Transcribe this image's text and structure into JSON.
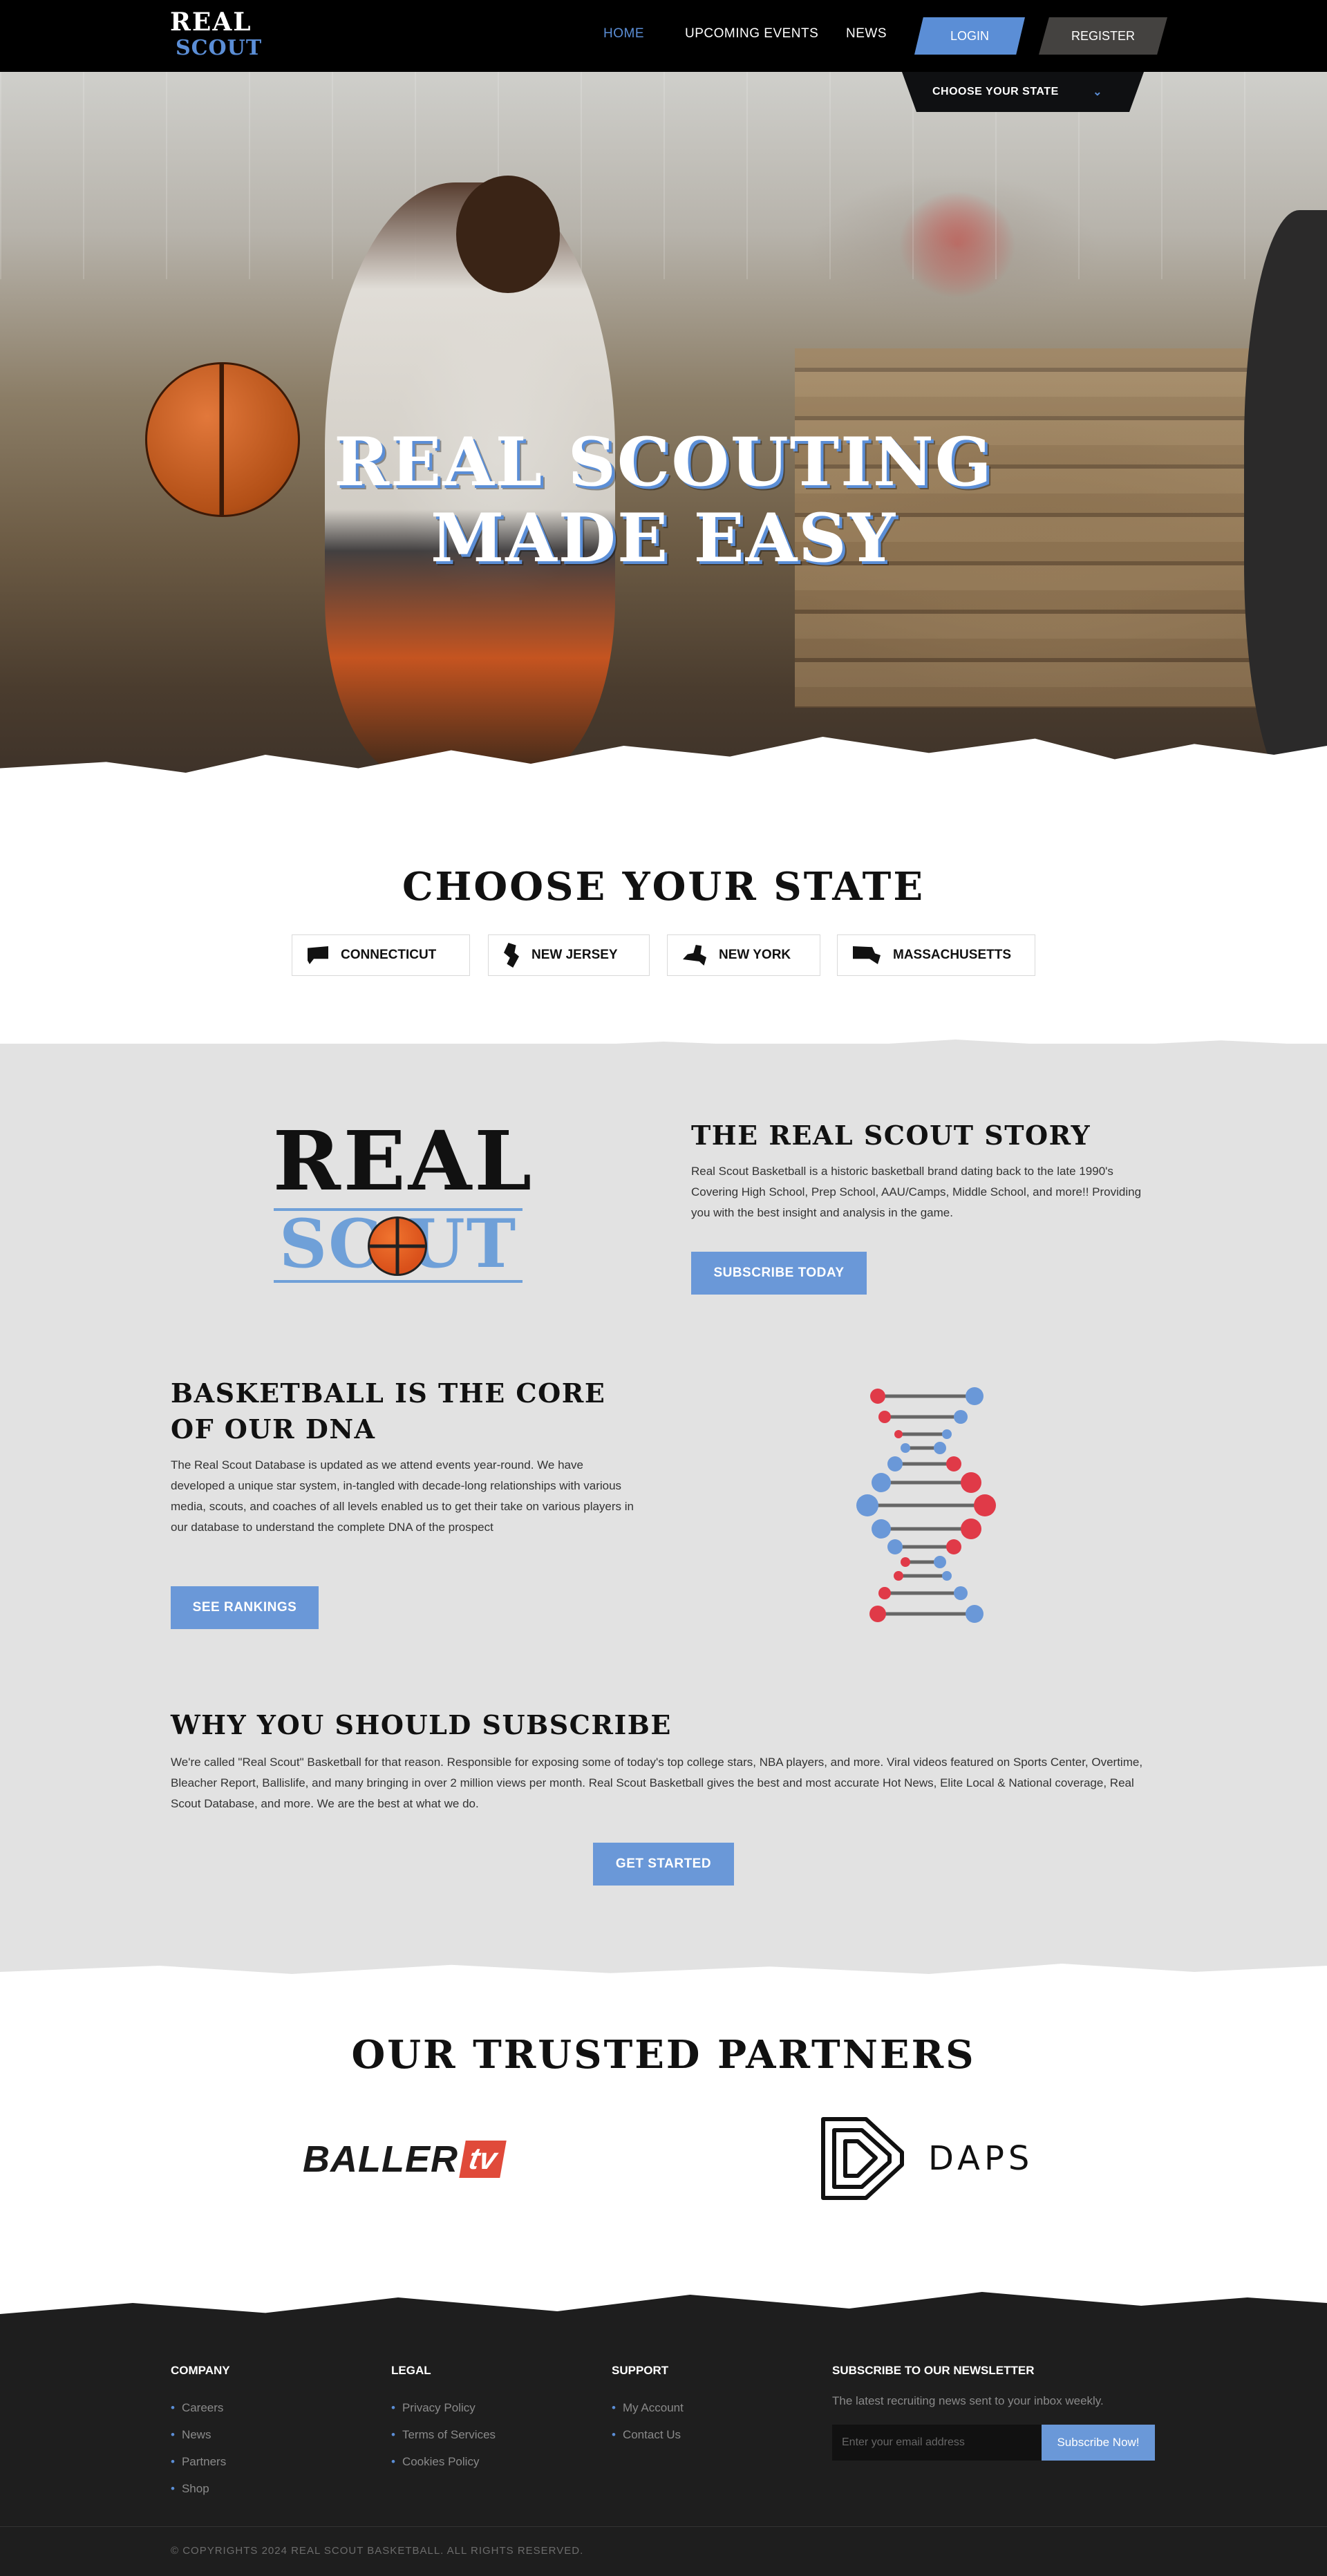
{
  "nav": {
    "logo_top": "REAL",
    "logo_bottom": "SCOUT",
    "links": [
      "HOME",
      "UPCOMING EVENTS",
      "NEWS"
    ],
    "login": "LOGIN",
    "register": "REGISTER",
    "state_dropdown": "CHOOSE YOUR STATE"
  },
  "hero": {
    "line1": "REAL SCOUTING",
    "line2": "MADE EASY"
  },
  "states": {
    "title": "CHOOSE YOUR STATE",
    "items": [
      "CONNECTICUT",
      "NEW JERSEY",
      "NEW YORK",
      "MASSACHUSETTS"
    ]
  },
  "story": {
    "logo_top": "REAL",
    "logo_bottom": "SC UT",
    "title": "THE REAL SCOUT STORY",
    "text": "Real Scout Basketball is a historic basketball brand dating back to the late 1990's   Covering High School, Prep School, AAU/Camps, Middle School, and more!! Providing you with the best insight and analysis in the game.",
    "button": "SUBSCRIBE TODAY"
  },
  "dna": {
    "title": "BASKETBALL IS THE CORE OF OUR DNA",
    "text": "The Real Scout Database is updated as we attend events year-round. We have developed a unique star system, in-tangled with decade-long relationships with various media, scouts, and coaches of all levels enabled us to get their take on various players in our database to understand the complete DNA of the prospect",
    "button": "SEE RANKINGS"
  },
  "why": {
    "title": "WHY YOU SHOULD SUBSCRIBE",
    "text": "We're called \"Real Scout\" Basketball for that reason. Responsible for exposing some of today's top college stars, NBA players, and more. Viral videos featured on Sports Center, Overtime, Bleacher Report, Ballislife, and many bringing in over 2 million views per month.  Real Scout Basketball gives the best and most accurate Hot News, Elite Local & National coverage, Real Scout Database, and more.  We are the best at what we do.",
    "button": "GET STARTED"
  },
  "partners": {
    "title": "OUR TRUSTED PARTNERS",
    "baller_text": "BALLER",
    "baller_tv": "tv",
    "daps": "DAPS"
  },
  "footer": {
    "company": {
      "title": "COMPANY",
      "links": [
        "Careers",
        "News",
        "Partners",
        "Shop"
      ]
    },
    "legal": {
      "title": "LEGAL",
      "links": [
        "Privacy Policy",
        "Terms of Services",
        "Cookies Policy"
      ]
    },
    "support": {
      "title": "SUPPORT",
      "links": [
        "My Account",
        "Contact Us"
      ]
    },
    "newsletter": {
      "title": "SUBSCRIBE TO OUR NEWSLETTER",
      "desc": "The latest recruiting news sent to your inbox weekly.",
      "placeholder": "Enter your email address",
      "button": "Subscribe Now!"
    },
    "copyright": "© COPYRIGHTS 2024 REAL SCOUT BASKETBALL. ALL RIGHTS RESERVED."
  },
  "colors": {
    "accent": "#5b8ed6",
    "button": "#6a98d8",
    "red": "#e04a3a",
    "footer": "#1e1e1e",
    "grey_section": "#e2e2e2"
  },
  "icons": [
    "chevron-down-icon",
    "connecticut-icon",
    "new-jersey-icon",
    "new-york-icon",
    "massachusetts-icon",
    "basketball-icon",
    "dna-icon",
    "daps-logo-icon"
  ]
}
